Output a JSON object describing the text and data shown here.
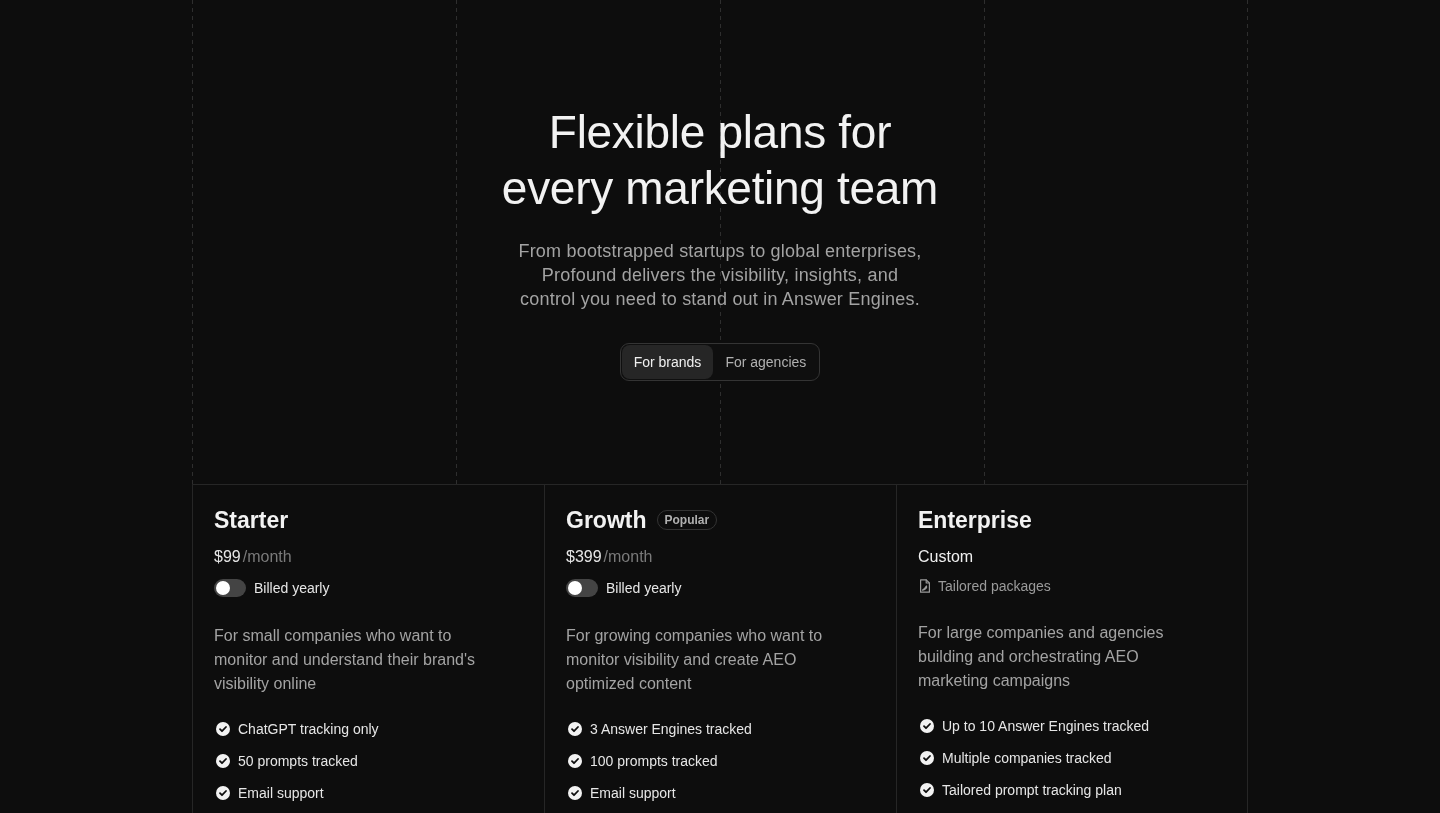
{
  "hero": {
    "title_lines": [
      "Flexible plans for",
      "every marketing team"
    ],
    "subtitle_lines": [
      "From bootstrapped startups to global enterprises,",
      "Profound delivers the visibility, insights, and",
      "control you need to stand out in Answer Engines."
    ],
    "audience_tabs": [
      {
        "label": "For brands",
        "selected": true
      },
      {
        "label": "For agencies",
        "selected": false
      }
    ]
  },
  "plans": [
    {
      "kind": "priced",
      "name": "Starter",
      "price": "$99",
      "period": "/month",
      "billing": {
        "label": "Billed yearly",
        "on": false
      },
      "description": "For small companies who want to monitor and understand their brand's visibility online",
      "features": [
        "ChatGPT tracking only",
        "50 prompts tracked",
        "Email support"
      ]
    },
    {
      "kind": "priced",
      "name": "Growth",
      "badge": "Popular",
      "price": "$399",
      "period": "/month",
      "billing": {
        "label": "Billed yearly",
        "on": false
      },
      "description": "For growing companies who want to monitor visibility and create AEO optimized content",
      "features": [
        "3 Answer Engines tracked",
        "100 prompts tracked",
        "Email support"
      ]
    },
    {
      "kind": "custom",
      "name": "Enterprise",
      "price": "Custom",
      "note": "Tailored packages",
      "description": "For large companies and agencies building and orchestrating AEO marketing campaigns",
      "features": [
        "Up to 10 Answer Engines tracked",
        "Multiple companies tracked",
        "Tailored prompt tracking plan"
      ]
    }
  ]
}
